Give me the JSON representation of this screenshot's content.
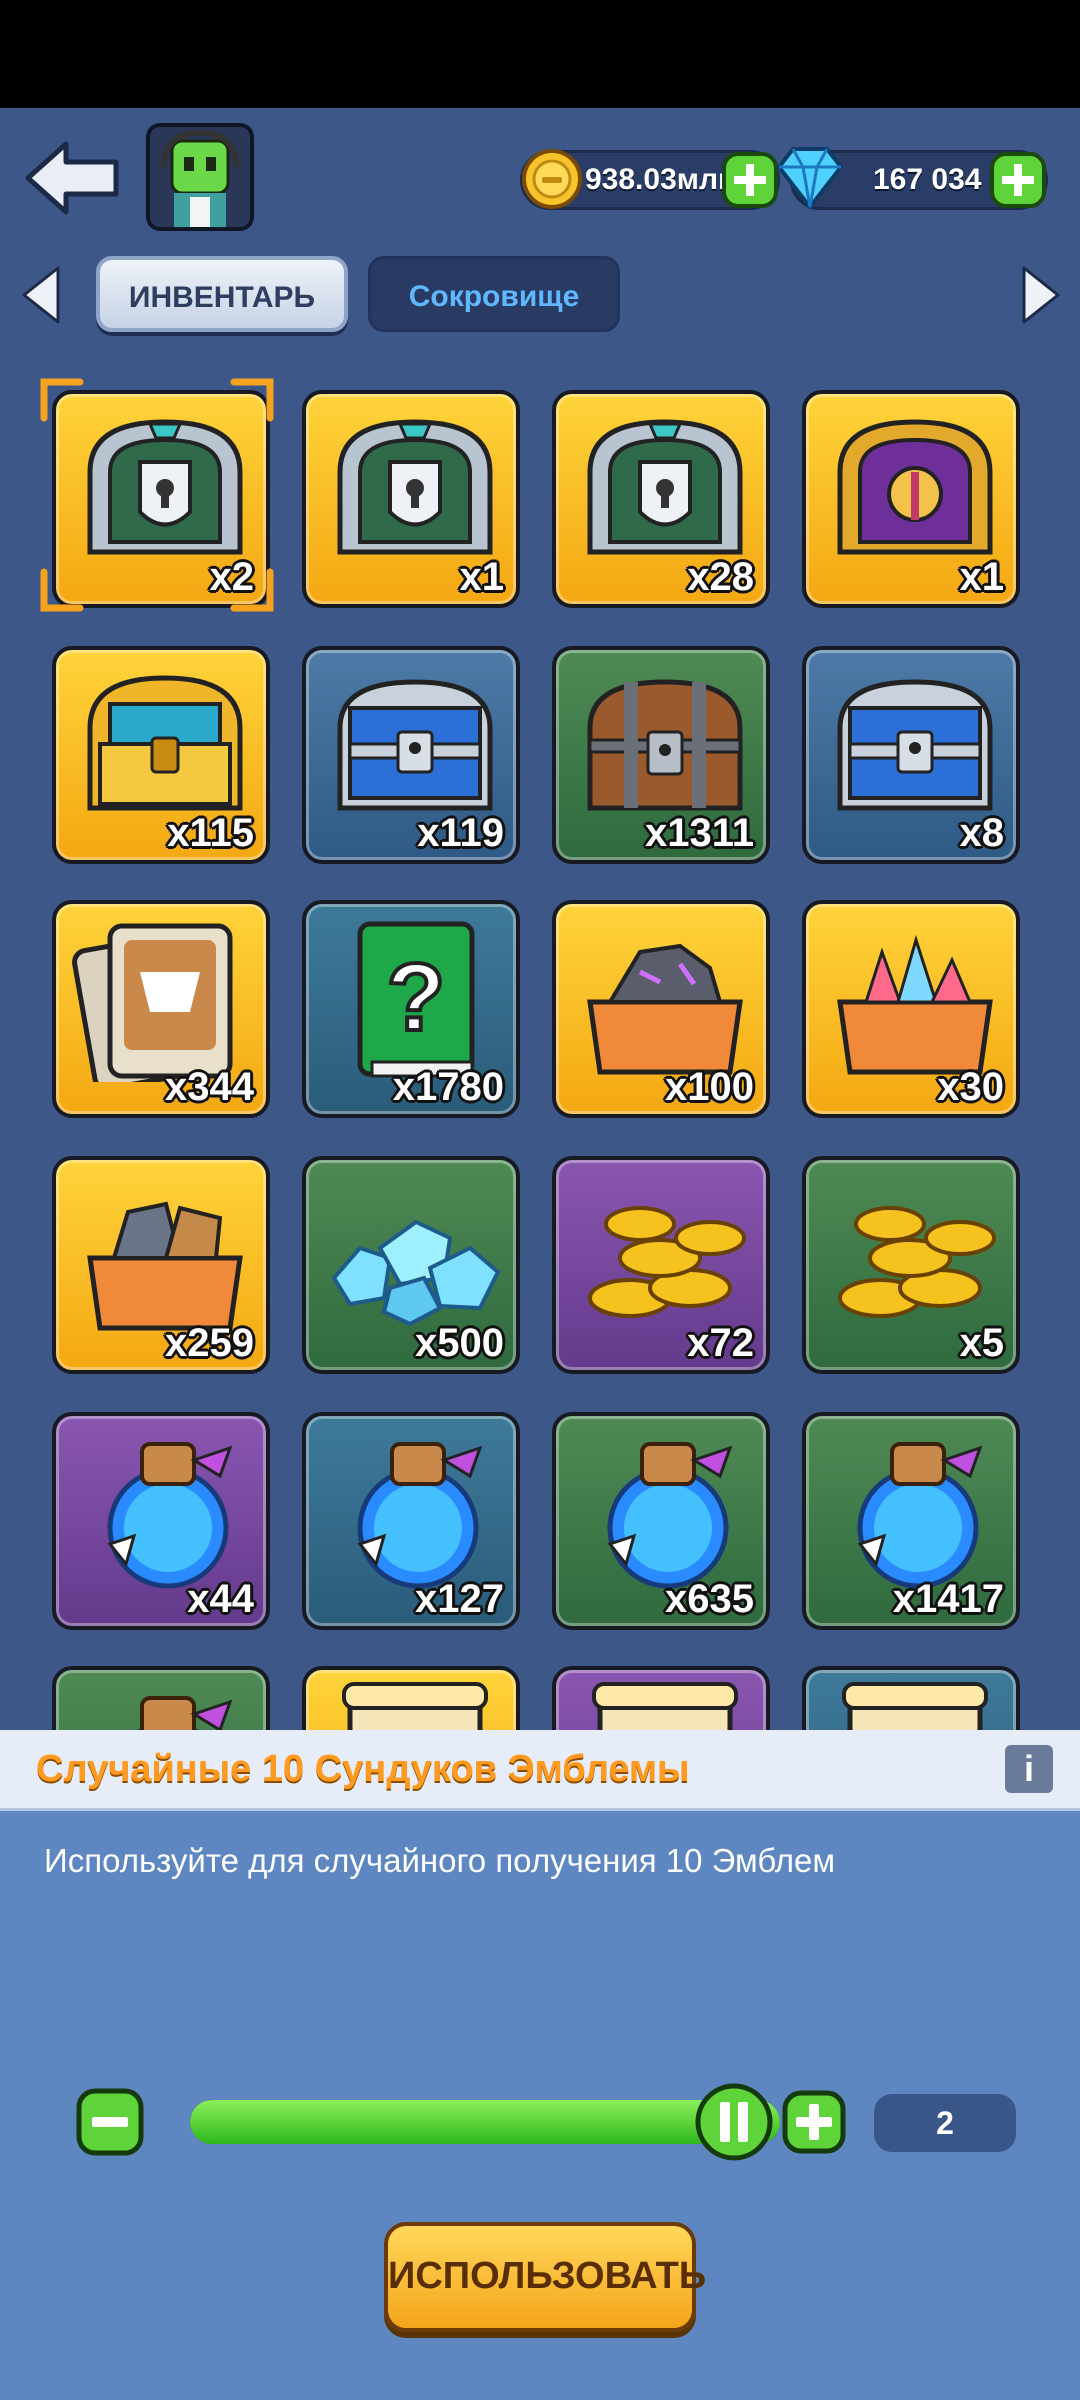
{
  "header": {
    "back_icon": "back-arrow-icon",
    "avatar_icon": "green-robot-avatar",
    "coins": "938.03млн",
    "gems": "167 034"
  },
  "tabs": {
    "inventory": "ИНВЕНТАРЬ",
    "treasure": "Сокровище"
  },
  "items": [
    {
      "qty": "x2",
      "icon": "emblem-chest-silver",
      "bg": "gold"
    },
    {
      "qty": "x1",
      "icon": "emblem-chest-silver",
      "bg": "gold"
    },
    {
      "qty": "x28",
      "icon": "emblem-chest-silver",
      "bg": "gold"
    },
    {
      "qty": "x1",
      "icon": "purple-gold-chest",
      "bg": "gold"
    },
    {
      "qty": "x115",
      "icon": "gold-chest",
      "bg": "gold"
    },
    {
      "qty": "x119",
      "icon": "blue-iron-chest",
      "bg": "blue"
    },
    {
      "qty": "x1311",
      "icon": "wooden-chest",
      "bg": "green"
    },
    {
      "qty": "x8",
      "icon": "blue-iron-chest",
      "bg": "blue"
    },
    {
      "qty": "x344",
      "icon": "hero-cards",
      "bg": "gold"
    },
    {
      "qty": "x1780",
      "icon": "mystery-book",
      "bg": "teal"
    },
    {
      "qty": "x100",
      "icon": "rune-stones-box",
      "bg": "gold"
    },
    {
      "qty": "x30",
      "icon": "crystal-box",
      "bg": "gold"
    },
    {
      "qty": "x259",
      "icon": "ore-box",
      "bg": "gold"
    },
    {
      "qty": "x500",
      "icon": "blue-crystals",
      "bg": "green"
    },
    {
      "qty": "x72",
      "icon": "gold-coins",
      "bg": "purple"
    },
    {
      "qty": "x5",
      "icon": "gold-coins",
      "bg": "green"
    },
    {
      "qty": "x44",
      "icon": "blue-potion",
      "bg": "purple"
    },
    {
      "qty": "x127",
      "icon": "blue-potion",
      "bg": "teal"
    },
    {
      "qty": "x635",
      "icon": "blue-potion",
      "bg": "green"
    },
    {
      "qty": "x1417",
      "icon": "blue-potion",
      "bg": "green"
    },
    {
      "qty": "",
      "icon": "blue-potion",
      "bg": "green"
    },
    {
      "qty": "",
      "icon": "scroll",
      "bg": "gold"
    },
    {
      "qty": "",
      "icon": "scroll",
      "bg": "purple"
    },
    {
      "qty": "",
      "icon": "scroll",
      "bg": "teal"
    }
  ],
  "selected_index": 0,
  "panel": {
    "title": "Случайные 10 Сундуков Эмблемы",
    "info": "i",
    "description": "Используйте для случайного получения 10 Эмблем",
    "count": "2",
    "slider_fraction": 1.0,
    "use_button": "ИСПОЛЬЗОВАТЬ"
  }
}
